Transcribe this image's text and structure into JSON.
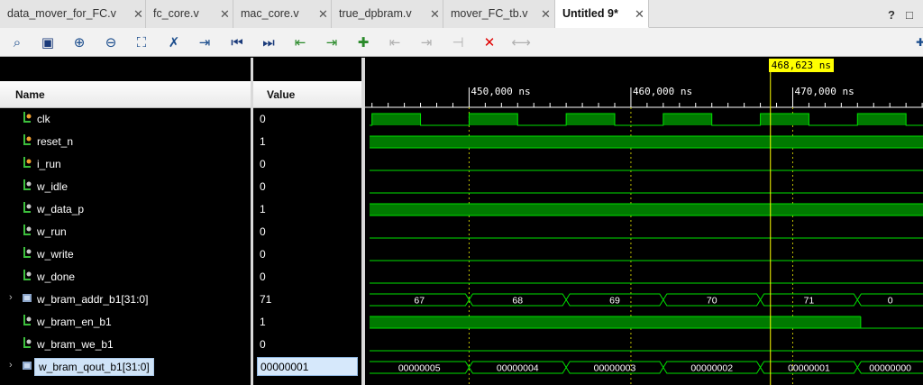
{
  "tabs": [
    {
      "label": "data_mover_for_FC.v",
      "active": false
    },
    {
      "label": "fc_core.v",
      "active": false
    },
    {
      "label": "mac_core.v",
      "active": false
    },
    {
      "label": "true_dpbram.v",
      "active": false
    },
    {
      "label": "mover_FC_tb.v",
      "active": false
    },
    {
      "label": "Untitled 9*",
      "active": true
    }
  ],
  "window_buttons": {
    "help": "?",
    "restore": "□"
  },
  "toolbar": {
    "icons": [
      "search-icon",
      "save-icon",
      "zoom-in-icon",
      "zoom-out-icon",
      "zoom-fit-icon",
      "cursor-to-markers-icon",
      "go-to-time-zero-icon",
      "go-to-first-icon",
      "go-to-last-icon",
      "previous-transition-icon",
      "next-transition-icon",
      "add-marker-icon",
      "previous-marker-icon",
      "next-marker-icon",
      "swap-cursors-icon",
      "delete-icon",
      "snap-icon"
    ]
  },
  "columns": {
    "name": "Name",
    "value": "Value"
  },
  "cursor": {
    "label": "468,623 ns",
    "time_ns": 468.623
  },
  "timeline": {
    "labels": [
      {
        "text": "450,000 ns",
        "t": 450
      },
      {
        "text": "460,000 ns",
        "t": 460
      },
      {
        "text": "470,000 ns",
        "t": 470
      }
    ],
    "view_start_ns": 443.85,
    "view_end_ns": 478.05
  },
  "signals": [
    {
      "name": "clk",
      "value": "0",
      "kind": "in",
      "type": "clock"
    },
    {
      "name": "reset_n",
      "value": "1",
      "kind": "in",
      "type": "level",
      "level": 1
    },
    {
      "name": "i_run",
      "value": "0",
      "kind": "in",
      "type": "level",
      "level": 0
    },
    {
      "name": "w_idle",
      "value": "0",
      "kind": "wire",
      "type": "level",
      "level": 0
    },
    {
      "name": "w_data_p",
      "value": "1",
      "kind": "wire",
      "type": "level",
      "level": 1
    },
    {
      "name": "w_run",
      "value": "0",
      "kind": "wire",
      "type": "level",
      "level": 0
    },
    {
      "name": "w_write",
      "value": "0",
      "kind": "wire",
      "type": "level",
      "level": 0
    },
    {
      "name": "w_done",
      "value": "0",
      "kind": "wire",
      "type": "level",
      "level": 0
    },
    {
      "name": "w_bram_addr_b1[31:0]",
      "value": "71",
      "kind": "bus",
      "type": "bus",
      "segments": [
        {
          "t0": 443.85,
          "t1": 450.0,
          "text": "67"
        },
        {
          "t0": 450.0,
          "t1": 456.0,
          "text": "68"
        },
        {
          "t0": 456.0,
          "t1": 462.0,
          "text": "69"
        },
        {
          "t0": 462.0,
          "t1": 468.0,
          "text": "70"
        },
        {
          "t0": 468.0,
          "t1": 474.0,
          "text": "71"
        },
        {
          "t0": 474.0,
          "t1": 478.05,
          "text": "0"
        }
      ]
    },
    {
      "name": "w_bram_en_b1",
      "value": "1",
      "kind": "wire",
      "type": "edges",
      "edges": [
        {
          "t": 443.85,
          "level": 1
        },
        {
          "t": 474.2,
          "level": 0
        }
      ]
    },
    {
      "name": "w_bram_we_b1",
      "value": "0",
      "kind": "wire",
      "type": "level",
      "level": 0
    },
    {
      "name": "w_bram_qout_b1[31:0]",
      "value": "00000001",
      "kind": "bus",
      "type": "bus",
      "selected": true,
      "segments": [
        {
          "t0": 443.85,
          "t1": 450.0,
          "text": "00000005"
        },
        {
          "t0": 450.0,
          "t1": 456.0,
          "text": "00000004"
        },
        {
          "t0": 456.0,
          "t1": 462.0,
          "text": "00000003"
        },
        {
          "t0": 462.0,
          "t1": 468.0,
          "text": "00000002"
        },
        {
          "t0": 468.0,
          "t1": 474.0,
          "text": "00000001"
        },
        {
          "t0": 474.0,
          "t1": 478.05,
          "text": "00000000"
        }
      ]
    }
  ],
  "clock": {
    "period_ns": 6.0,
    "first_rise_ns": 444.0,
    "high_ns": 3.0
  },
  "colors": {
    "wave": "#00e000",
    "fill": "#007a00",
    "cursor": "#ffff00",
    "grid": "#bfbf00",
    "text": "#ffffff",
    "close": "#e00000"
  }
}
